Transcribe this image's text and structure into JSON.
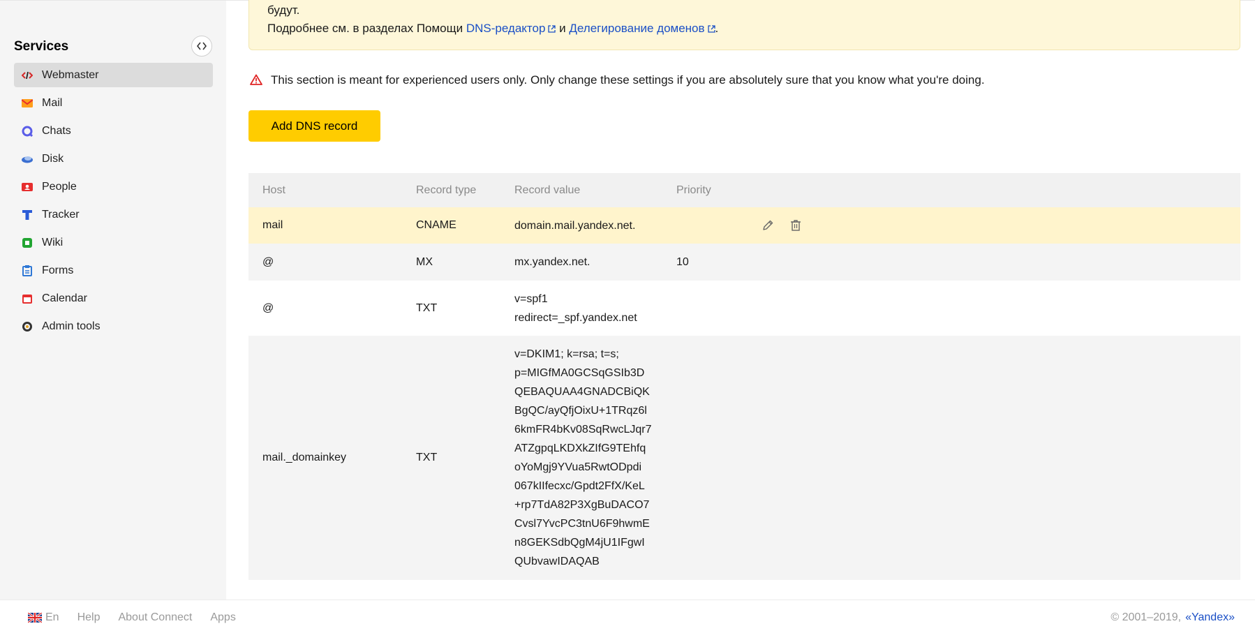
{
  "sidebar": {
    "title": "Services",
    "items": [
      {
        "label": "Webmaster",
        "icon": "webmaster-icon",
        "active": true
      },
      {
        "label": "Mail",
        "icon": "mail-icon"
      },
      {
        "label": "Chats",
        "icon": "chats-icon"
      },
      {
        "label": "Disk",
        "icon": "disk-icon"
      },
      {
        "label": "People",
        "icon": "people-icon"
      },
      {
        "label": "Tracker",
        "icon": "tracker-icon"
      },
      {
        "label": "Wiki",
        "icon": "wiki-icon"
      },
      {
        "label": "Forms",
        "icon": "forms-icon"
      },
      {
        "label": "Calendar",
        "icon": "calendar-icon"
      },
      {
        "label": "Admin tools",
        "icon": "admin-tools-icon"
      }
    ]
  },
  "banner": {
    "line1": "будут.",
    "line2_prefix": "Подробнее см. в разделах Помощи ",
    "link1": "DNS-редактор",
    "connector": " и ",
    "link2": "Делегирование доменов",
    "suffix": "."
  },
  "warning": {
    "text": "This section is meant for experienced users only. Only change these settings if you are absolutely sure that you know what you're doing."
  },
  "add_button": {
    "label": "Add DNS record"
  },
  "table": {
    "headers": {
      "host": "Host",
      "type": "Record type",
      "value": "Record value",
      "priority": "Priority"
    },
    "rows": [
      {
        "host": "mail",
        "type": "CNAME",
        "value": "domain.mail.yandex.net.",
        "priority": ""
      },
      {
        "host": "@",
        "type": "MX",
        "value": "mx.yandex.net.",
        "priority": "10"
      },
      {
        "host": "@",
        "type": "TXT",
        "value": "v=spf1\nredirect=_spf.yandex.net",
        "priority": ""
      },
      {
        "host": "mail._domainkey",
        "type": "TXT",
        "value": "v=DKIM1; k=rsa; t=s;\np=MIGfMA0GCSqGSIb3D\nQEBAQUAA4GNADCBiQK\nBgQC/ayQfjOixU+1TRqz6l\n6kmFR4bKv08SqRwcLJqr7\nATZgpqLKDXkZIfG9TEhfq\noYoMgj9YVua5RwtODpdi\n067kIIfecxc/Gpdt2FfX/KeL\n+rp7TdA82P3XgBuDACO7\nCvsl7YvcPC3tnU6F9hwmE\nn8GEKSdbQgM4jU1IFgwI\nQUbvawIDAQAB",
        "priority": ""
      }
    ]
  },
  "footer": {
    "lang": "En",
    "help": "Help",
    "about": "About Connect",
    "apps": "Apps",
    "copyright": "© 2001–2019,",
    "brand": "«Yandex»"
  },
  "colors": {
    "accent": "#ffcc00",
    "link": "#1a4fc6",
    "highlight_row": "#fff4cc",
    "banner": "#fef7d9"
  }
}
